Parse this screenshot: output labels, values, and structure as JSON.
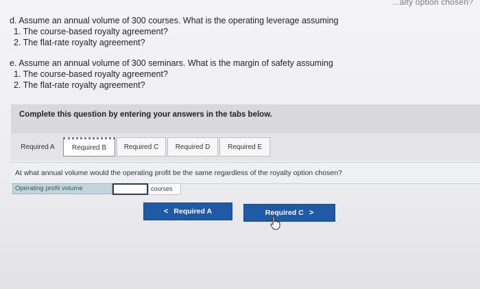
{
  "top_cutoff": "...alty option chosen?",
  "question_d": {
    "prompt": "d. Assume an annual volume of 300 courses. What is the operating leverage assuming",
    "items": [
      "1. The course-based royalty agreement?",
      "2. The flat-rate royalty agreement?"
    ]
  },
  "question_e": {
    "prompt": "e. Assume an annual volume of 300 seminars. What is the margin of safety assuming",
    "items": [
      "1. The course-based royalty agreement?",
      "2. The flat-rate royalty agreement?"
    ]
  },
  "instruction": "Complete this question by entering your answers in the tabs below.",
  "tabs": [
    "Required A",
    "Required B",
    "Required C",
    "Required D",
    "Required E"
  ],
  "active_tab": "Required B",
  "tab_question": "At what annual volume would the operating profit be the same regardless of the royalty option chosen?",
  "answer": {
    "label": "Operating profit volume",
    "value": "",
    "unit": "courses"
  },
  "nav": {
    "prev_label": "Required A",
    "next_label": "Required C",
    "prev_chevron": "<",
    "next_chevron": ">"
  },
  "colors": {
    "nav_button": "#1f5aa6",
    "answer_label_bg": "#c5d4da",
    "input_border": "#2b3a55"
  }
}
